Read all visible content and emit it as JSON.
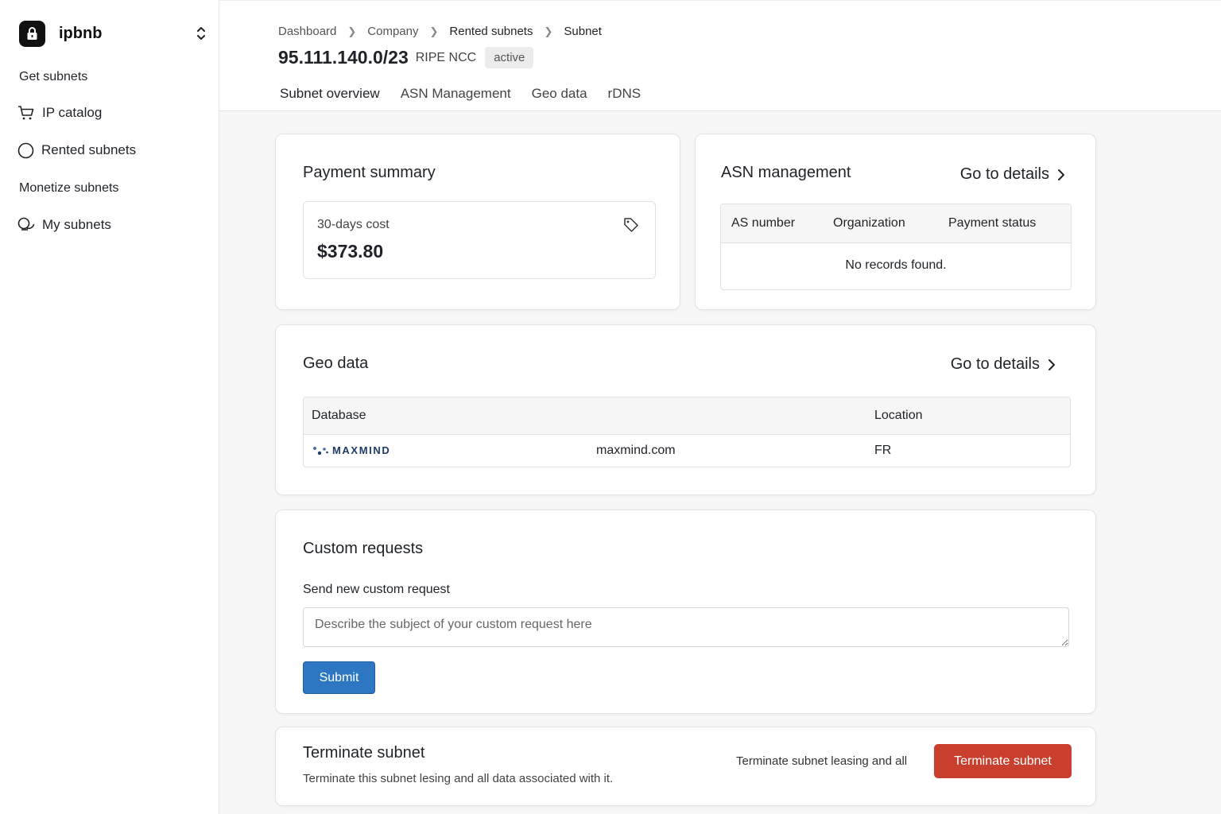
{
  "brand": {
    "name": "ipbnb"
  },
  "sidebar": {
    "sections": [
      {
        "label": "Get subnets"
      },
      {
        "label": "Monetize subnets"
      }
    ],
    "items": [
      {
        "label": "IP catalog",
        "icon": "cart-icon"
      },
      {
        "label": "Rented subnets",
        "icon": "circle-icon"
      },
      {
        "label": "My subnets",
        "icon": "coins-icon"
      }
    ]
  },
  "header": {
    "breadcrumbs": [
      "Dashboard",
      "Company",
      "Rented subnets",
      "Subnet"
    ],
    "title": "95.111.140.0/23",
    "registry": "RIPE NCC",
    "status": "active",
    "tabs": [
      "Subnet overview",
      "ASN Management",
      "Geo data",
      "rDNS"
    ]
  },
  "payment": {
    "title": "Payment summary",
    "cost_label": "30-days cost",
    "cost_value": "$373.80"
  },
  "asn": {
    "title": "ASN management",
    "go_details": "Go to details",
    "columns": [
      "AS number",
      "Organization",
      "Payment status"
    ],
    "empty": "No records found."
  },
  "geo": {
    "title": "Geo data",
    "go_details": "Go to details",
    "columns": [
      "Database",
      "Location"
    ],
    "rows": [
      {
        "logo": "MAXMIND",
        "domain": "maxmind.com",
        "location": "FR"
      }
    ]
  },
  "custom": {
    "title": "Custom requests",
    "label": "Send new custom request",
    "placeholder": "Describe the subject of your custom request here",
    "submit": "Submit"
  },
  "terminate": {
    "title": "Terminate subnet",
    "description": "Terminate this subnet lesing and all data associated with it.",
    "side_text": "Terminate subnet leasing and all",
    "button": "Terminate subnet"
  },
  "colors": {
    "primary": "#2d77c2",
    "danger": "#c8402d",
    "tab_underline": "#4a6fa5"
  }
}
